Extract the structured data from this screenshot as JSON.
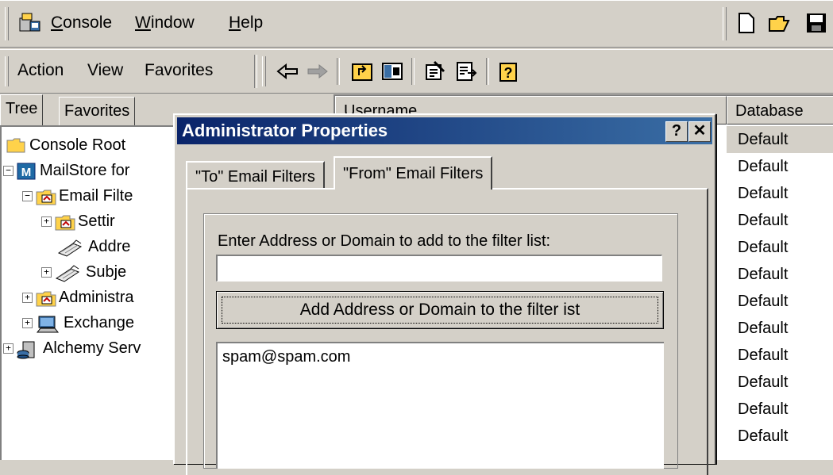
{
  "menubar": {
    "items": [
      {
        "label": "Console",
        "ul": "C"
      },
      {
        "label": "Window",
        "ul": "W"
      },
      {
        "label": "Help",
        "ul": "H"
      }
    ]
  },
  "toolbar": {
    "menus": [
      {
        "label": "Action"
      },
      {
        "label": "View"
      },
      {
        "label": "Favorites"
      }
    ]
  },
  "tree": {
    "tabs": [
      {
        "label": "Tree"
      },
      {
        "label": "Favorites"
      }
    ],
    "nodes": [
      {
        "label": "Console Root"
      },
      {
        "label": "MailStore for"
      },
      {
        "label": "Email Filte"
      },
      {
        "label": "Settir"
      },
      {
        "label": "Addre"
      },
      {
        "label": "Subje"
      },
      {
        "label": "Administra"
      },
      {
        "label": "Exchange"
      },
      {
        "label": "Alchemy Serv"
      }
    ]
  },
  "list": {
    "columns": [
      {
        "label": "Username"
      },
      {
        "label": "Database"
      }
    ],
    "rows": [
      "Default",
      "Default",
      "Default",
      "Default",
      "Default",
      "Default",
      "Default",
      "Default",
      "Default",
      "Default",
      "Default",
      "Default"
    ]
  },
  "dialog": {
    "title": "Administrator Properties",
    "help_label": "?",
    "close_label": "✕",
    "tabs": [
      {
        "label": "\"To\" Email Filters"
      },
      {
        "label": "\"From\" Email Filters"
      }
    ],
    "filter_label": "Enter Address or Domain to add to the filter list:",
    "input_value": "",
    "add_button_label": "Add Address or Domain to the filter ist",
    "filter_entries": [
      "spam@spam.com"
    ]
  },
  "colors": {
    "titlebar_start": "#0a246a",
    "titlebar_end": "#3a6ea5",
    "face": "#d4d0c8"
  }
}
